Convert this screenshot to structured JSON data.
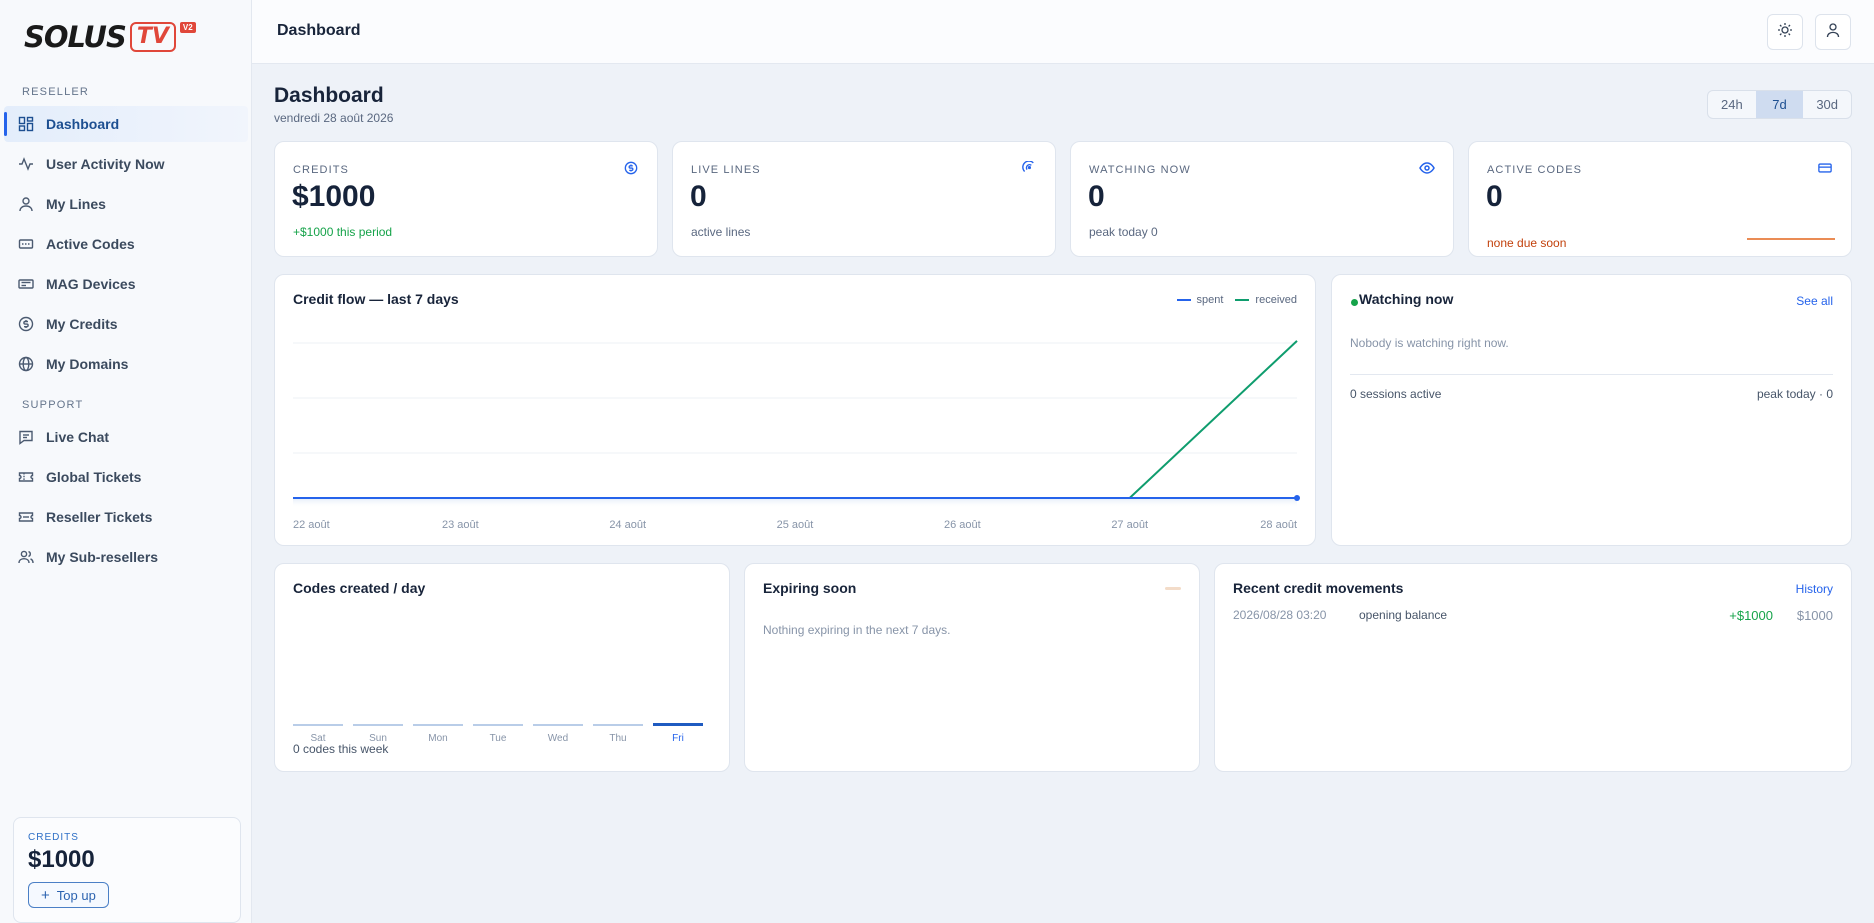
{
  "brand": {
    "word": "SOLUS",
    "tv": "TV",
    "version": "V2"
  },
  "sidebar": {
    "section_reseller": "RESELLER",
    "section_support": "SUPPORT",
    "items": [
      {
        "label": "Dashboard",
        "icon": "grid-icon"
      },
      {
        "label": "User Activity Now",
        "icon": "activity-icon"
      },
      {
        "label": "My Lines",
        "icon": "user-icon"
      },
      {
        "label": "Active Codes",
        "icon": "ticket-icon"
      },
      {
        "label": "MAG Devices",
        "icon": "device-icon"
      },
      {
        "label": "My Credits",
        "icon": "dollar-icon"
      },
      {
        "label": "My Domains",
        "icon": "globe-icon"
      },
      {
        "label": "Live Chat",
        "icon": "chat-icon"
      },
      {
        "label": "Global Tickets",
        "icon": "ticket-icon"
      },
      {
        "label": "Reseller Tickets",
        "icon": "ticket-icon"
      },
      {
        "label": "My Sub-resellers",
        "icon": "users-icon"
      }
    ],
    "credit_box": {
      "label": "CREDITS",
      "value": "$1000",
      "topup": "Top up"
    }
  },
  "topbar": {
    "title": "Dashboard"
  },
  "header": {
    "title": "Dashboard",
    "date": "vendredi 28 août 2026",
    "ranges": [
      "24h",
      "7d",
      "30d"
    ],
    "selected_range": "7d"
  },
  "stats": [
    {
      "label": "CREDITS",
      "value": "$1000",
      "sub": "+$1000 this period",
      "icon": "dollar-icon"
    },
    {
      "label": "LIVE LINES",
      "value": "0",
      "sub": "active lines",
      "icon": "signal-icon"
    },
    {
      "label": "WATCHING NOW",
      "value": "0",
      "sub": "peak today 0",
      "icon": "eye-icon"
    },
    {
      "label": "ACTIVE CODES",
      "value": "0",
      "sub": "none due soon",
      "icon": "card-icon"
    }
  ],
  "credit_flow": {
    "title": "Credit flow — last 7 days",
    "legend_spent": "spent",
    "legend_received": "received"
  },
  "chart_data": {
    "type": "line",
    "x": [
      "22 août",
      "23 août",
      "24 août",
      "25 août",
      "26 août",
      "27 août",
      "28 août"
    ],
    "series": [
      {
        "name": "spent",
        "values": [
          0,
          0,
          0,
          0,
          0,
          0,
          0
        ],
        "color": "#2563eb"
      },
      {
        "name": "received",
        "values": [
          0,
          0,
          0,
          0,
          0,
          0,
          1000
        ],
        "color": "#0f9d6e"
      }
    ],
    "ylim": [
      0,
      1050
    ],
    "grid": true
  },
  "watching": {
    "title": "Watching now",
    "see_all": "See all",
    "empty": "Nobody is watching right now.",
    "sessions": "0 sessions active",
    "peak": "peak today · 0"
  },
  "codes": {
    "title": "Codes created / day",
    "days": [
      "Sat",
      "Sun",
      "Mon",
      "Tue",
      "Wed",
      "Thu",
      "Fri"
    ],
    "values": [
      0,
      0,
      0,
      0,
      0,
      0,
      0
    ],
    "highlight": "Fri",
    "footer": "0 codes this week"
  },
  "expiring": {
    "title": "Expiring soon",
    "empty": "Nothing expiring in the next 7 days."
  },
  "movements": {
    "title": "Recent credit movements",
    "history": "History",
    "rows": [
      {
        "date": "2026/08/28 03:20",
        "desc": "opening balance",
        "amount": "+$1000",
        "balance": "$1000"
      }
    ]
  }
}
